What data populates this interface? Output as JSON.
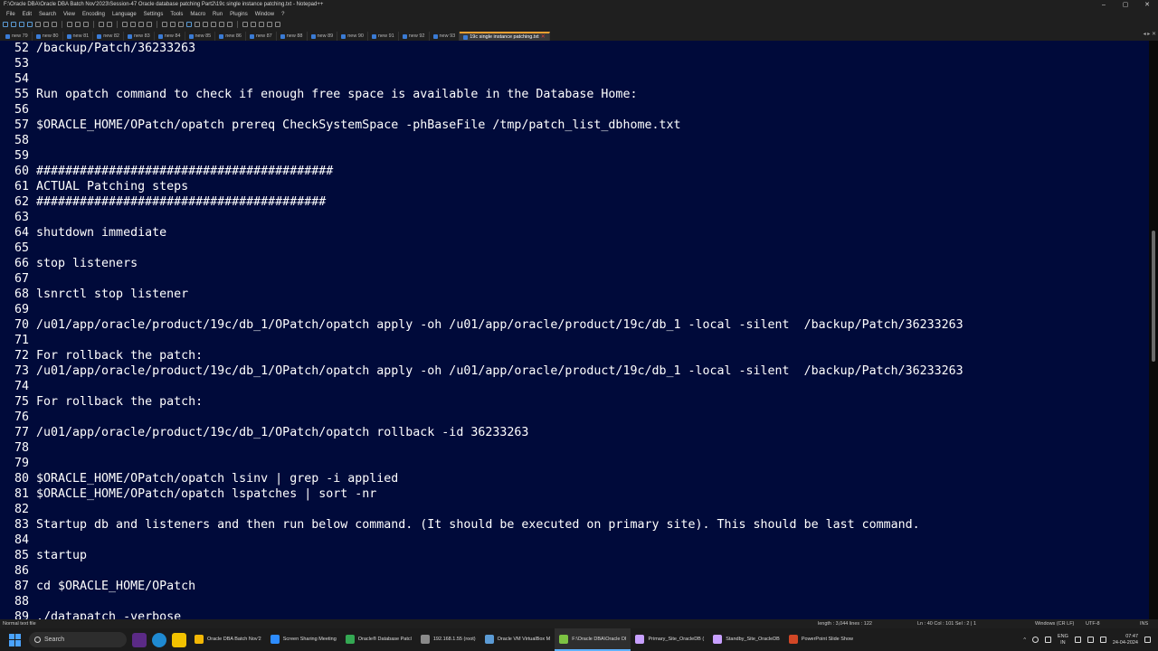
{
  "window": {
    "title": "F:\\Oracle DBA\\Oracle DBA Batch Nov'2023\\Session-47 Oracle database patching Part2\\19c single instance patching.txt - Notepad++",
    "controls": [
      "–",
      "▢",
      "✕"
    ]
  },
  "menu": [
    "File",
    "Edit",
    "Search",
    "View",
    "Encoding",
    "Language",
    "Settings",
    "Tools",
    "Macro",
    "Run",
    "Plugins",
    "Window",
    "?"
  ],
  "tabs": [
    {
      "label": "new 79",
      "active": false
    },
    {
      "label": "new 80",
      "active": false
    },
    {
      "label": "new 81",
      "active": false
    },
    {
      "label": "new 82",
      "active": false
    },
    {
      "label": "new 83",
      "active": false
    },
    {
      "label": "new 84",
      "active": false
    },
    {
      "label": "new 85",
      "active": false
    },
    {
      "label": "new 86",
      "active": false
    },
    {
      "label": "new 87",
      "active": false
    },
    {
      "label": "new 88",
      "active": false
    },
    {
      "label": "new 89",
      "active": false
    },
    {
      "label": "new 90",
      "active": false
    },
    {
      "label": "new 91",
      "active": false
    },
    {
      "label": "new 92",
      "active": false
    },
    {
      "label": "new 93",
      "active": false
    },
    {
      "label": "19c single instance patching.txt",
      "active": true
    }
  ],
  "editor": {
    "lines": [
      {
        "n": "52",
        "t": "/backup/Patch/36233263"
      },
      {
        "n": "53",
        "t": ""
      },
      {
        "n": "54",
        "t": ""
      },
      {
        "n": "55",
        "t": "Run opatch command to check if enough free space is available in the Database Home:"
      },
      {
        "n": "56",
        "t": ""
      },
      {
        "n": "57",
        "t": "$ORACLE_HOME/OPatch/opatch prereq CheckSystemSpace -phBaseFile /tmp/patch_list_dbhome.txt"
      },
      {
        "n": "58",
        "t": ""
      },
      {
        "n": "59",
        "t": ""
      },
      {
        "n": "60",
        "t": "#########################################"
      },
      {
        "n": "61",
        "t": "ACTUAL Patching steps"
      },
      {
        "n": "62",
        "t": "########################################"
      },
      {
        "n": "63",
        "t": ""
      },
      {
        "n": "64",
        "t": "shutdown immediate"
      },
      {
        "n": "65",
        "t": ""
      },
      {
        "n": "66",
        "t": "stop listeners"
      },
      {
        "n": "67",
        "t": ""
      },
      {
        "n": "68",
        "t": "lsnrctl stop listener"
      },
      {
        "n": "69",
        "t": ""
      },
      {
        "n": "70",
        "t": "/u01/app/oracle/product/19c/db_1/OPatch/opatch apply -oh /u01/app/oracle/product/19c/db_1 -local -silent  /backup/Patch/36233263"
      },
      {
        "n": "71",
        "t": ""
      },
      {
        "n": "72",
        "t": "For rollback the patch:"
      },
      {
        "n": "73",
        "t": "/u01/app/oracle/product/19c/db_1/OPatch/opatch apply -oh /u01/app/oracle/product/19c/db_1 -local -silent  /backup/Patch/36233263"
      },
      {
        "n": "74",
        "t": ""
      },
      {
        "n": "75",
        "t": "For rollback the patch:"
      },
      {
        "n": "76",
        "t": ""
      },
      {
        "n": "77",
        "t": "/u01/app/oracle/product/19c/db_1/OPatch/opatch rollback -id 36233263"
      },
      {
        "n": "78",
        "t": ""
      },
      {
        "n": "79",
        "t": ""
      },
      {
        "n": "80",
        "t": "$ORACLE_HOME/OPatch/opatch lsinv | grep -i applied"
      },
      {
        "n": "81",
        "t": "$ORACLE_HOME/OPatch/opatch lspatches | sort -nr"
      },
      {
        "n": "82",
        "t": ""
      },
      {
        "n": "83",
        "t": "Startup db and listeners and then run below command. (It should be executed on primary site). This should be last command."
      },
      {
        "n": "84",
        "t": ""
      },
      {
        "n": "85",
        "t": "startup"
      },
      {
        "n": "86",
        "t": ""
      },
      {
        "n": "87",
        "t": "cd $ORACLE_HOME/OPatch"
      },
      {
        "n": "88",
        "t": ""
      },
      {
        "n": "89",
        "t": "./datapatch -verbose"
      }
    ]
  },
  "status": {
    "filetype": "Normal text file",
    "length": "length : 3,044    lines : 122",
    "position": "Ln : 40    Col : 101    Sel : 2 | 1",
    "eol": "Windows (CR LF)",
    "encoding": "UTF-8",
    "mode": "INS"
  },
  "taskbar": {
    "search_placeholder": "Search",
    "apps": [
      {
        "label": "Oracle DBA Batch Nov'2",
        "color": "#f2b705",
        "active": false
      },
      {
        "label": "Screen Sharing Meeting",
        "color": "#2d8cff",
        "active": false
      },
      {
        "label": "Oracle® Database Patcl",
        "color": "#34a853",
        "active": false
      },
      {
        "label": "192.168.1.55 (root)",
        "color": "#8a8a8a",
        "active": false
      },
      {
        "label": "Oracle VM VirtualBox M",
        "color": "#5b9bd5",
        "active": false
      },
      {
        "label": "F:\\Oracle DBA\\Oracle DI",
        "color": "#7cc242",
        "active": true
      },
      {
        "label": "Primary_Site_OracleDB (",
        "color": "#c8a0ff",
        "active": false
      },
      {
        "label": "Standby_Site_OracleDB",
        "color": "#c8a0ff",
        "active": false
      },
      {
        "label": "PowerPoint Slide Show",
        "color": "#d24726",
        "active": false
      }
    ],
    "lang": {
      "a": "ENG",
      "b": "IN"
    },
    "clock": {
      "time": "07:47",
      "date": "24-04-2024"
    },
    "tray_arrow": "^"
  }
}
